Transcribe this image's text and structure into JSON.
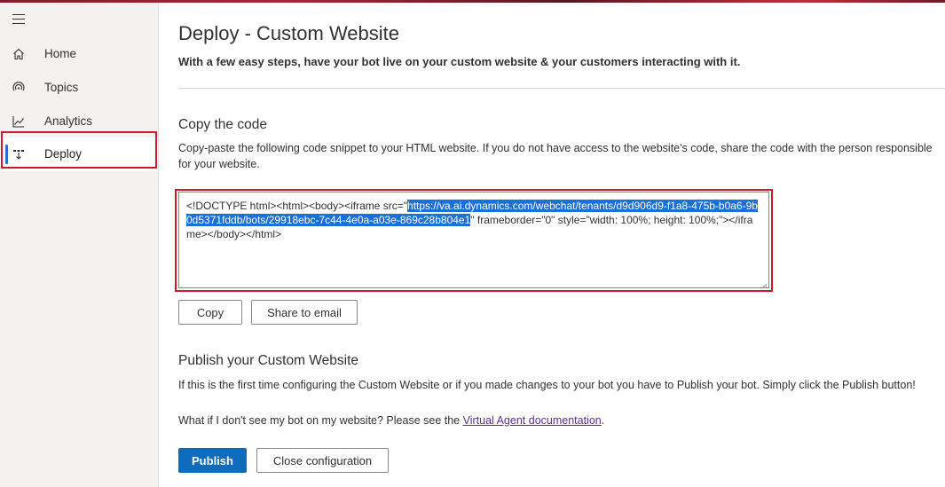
{
  "sidebar": {
    "items": [
      {
        "label": "Home",
        "icon": "home-icon"
      },
      {
        "label": "Topics",
        "icon": "topics-icon"
      },
      {
        "label": "Analytics",
        "icon": "analytics-icon"
      },
      {
        "label": "Deploy",
        "icon": "deploy-icon",
        "active": true
      }
    ]
  },
  "header": {
    "title": "Deploy - Custom Website",
    "subtitle": "With a few easy steps, have your bot live on your custom website & your customers interacting with it."
  },
  "copy_section": {
    "title": "Copy the code",
    "description": "Copy-paste the following code snippet to your HTML website. If you do not have access to the website's code, share the code with the person responsible for your website.",
    "code_prefix": "<!DOCTYPE html><html><body><iframe src=\"",
    "code_url": "https://va.ai.dynamics.com/webchat/tenants/d9d906d9-f1a8-475b-b0a6-9b0d5371fddb/bots/29918ebc-7c44-4e0a-a03e-869c28b804e1",
    "code_suffix": "\" frameborder=\"0\" style=\"width: 100%; height: 100%;\"></iframe></body></html>",
    "copy_button": "Copy",
    "share_button": "Share to email"
  },
  "publish_section": {
    "title": "Publish your Custom Website",
    "description": "If this is the first time configuring the Custom Website or if you made changes to your bot you have to Publish your bot. Simply click the Publish button!",
    "help_text": "What if I don't see my bot on my website? Please see the ",
    "help_link": "Virtual Agent documentation",
    "help_end": ".",
    "publish_button": "Publish",
    "close_button": "Close configuration"
  },
  "colors": {
    "accent": "#0f6cbd",
    "highlight": "#d1182a",
    "selection": "#1a6fd8",
    "link": "#5c2d91"
  }
}
